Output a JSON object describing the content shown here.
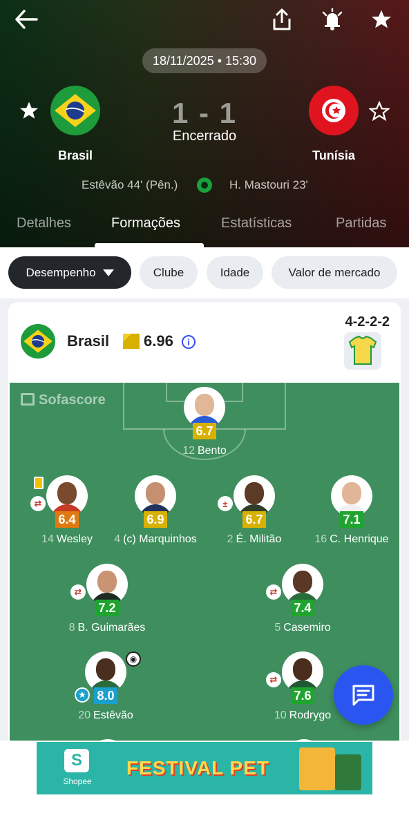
{
  "header": {
    "datetime": "18/11/2025 • 15:30",
    "home": {
      "name": "Brasil"
    },
    "away": {
      "name": "Tunísia"
    },
    "score": "1 - 1",
    "status": "Encerrado",
    "home_scorer": "Estêvão 44' (Pên.)",
    "away_scorer": "H. Mastouri 23'"
  },
  "tabs": [
    {
      "label": "Detalhes"
    },
    {
      "label": "Formações"
    },
    {
      "label": "Estatísticas"
    },
    {
      "label": "Partidas"
    }
  ],
  "filters": {
    "performance": "Desempenho",
    "club": "Clube",
    "age": "Idade",
    "market_value": "Valor de mercado"
  },
  "lineup": {
    "team": "Brasil",
    "rating": "6.96",
    "formation": "4-2-2-2",
    "info": "i",
    "watermark": "Sofascore",
    "players": [
      {
        "number": "12",
        "name": "Bento",
        "rating": "6.7"
      },
      {
        "number": "14",
        "name": "Wesley",
        "rating": "6.4"
      },
      {
        "number": "4",
        "name": "(c) Marquinhos",
        "rating": "6.9"
      },
      {
        "number": "2",
        "name": "É. Militão",
        "rating": "6.7"
      },
      {
        "number": "16",
        "name": "C. Henrique",
        "rating": "7.1"
      },
      {
        "number": "8",
        "name": "B. Guimarães",
        "rating": "7.2"
      },
      {
        "number": "5",
        "name": "Casemiro",
        "rating": "7.4"
      },
      {
        "number": "20",
        "name": "Estêvão",
        "rating": "8.0"
      },
      {
        "number": "10",
        "name": "Rodrygo",
        "rating": "7.6"
      }
    ]
  },
  "ad": {
    "brand": "Shopee",
    "logo_letter": "S",
    "title": "FESTIVAL PET"
  },
  "colors": {
    "rating_yellow": "#d8b100",
    "rating_orange": "#e07a10",
    "rating_green": "#1fa52f",
    "rating_blue": "#1aa0cc",
    "pitch": "#3f8f5e",
    "fab": "#2b55f0"
  },
  "icons": [
    "back-arrow-icon",
    "share-icon",
    "bell-icon",
    "star-icon",
    "soccer-ball-icon",
    "info-icon",
    "jersey-icon",
    "substitution-icon",
    "yellow-card-icon",
    "player-of-match-icon",
    "assist-icon",
    "chat-icon"
  ]
}
